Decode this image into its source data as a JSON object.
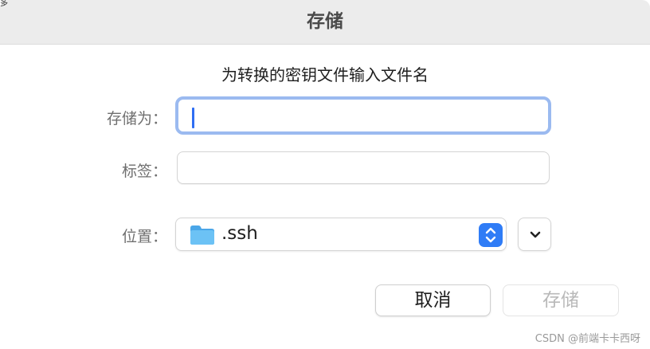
{
  "dialog": {
    "title": "存储",
    "prompt": "为转换的密钥文件输入文件名",
    "corner_text": "多"
  },
  "fields": {
    "save_as_label": "存储为：",
    "save_as_value": "",
    "tags_label": "标签：",
    "tags_value": "",
    "location_label": "位置：",
    "location_value": ".ssh",
    "location_icon": "folder-icon"
  },
  "buttons": {
    "cancel": "取消",
    "save": "存储"
  },
  "watermark": "CSDN @前端卡卡西呀",
  "colors": {
    "accent": "#2f7cf6",
    "focus_ring": "#9bbaf0",
    "titlebar": "#ececec",
    "disabled_text": "#b9b9b9",
    "folder": "#5ab4ee"
  }
}
